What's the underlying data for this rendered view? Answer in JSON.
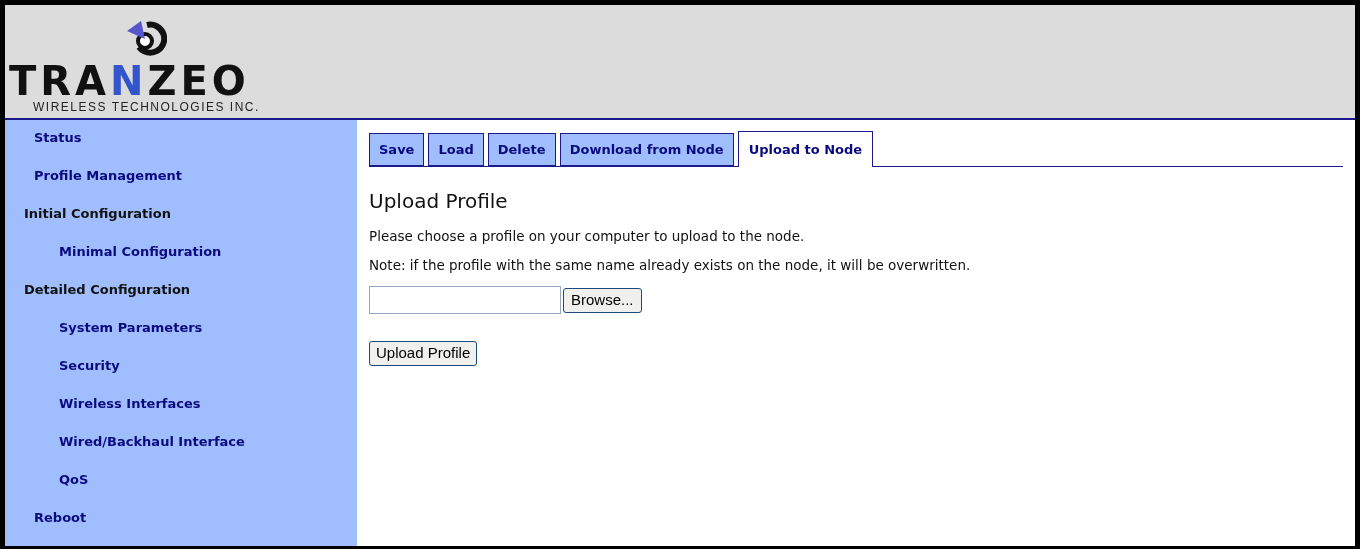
{
  "logo": {
    "parts": [
      {
        "text": "TRA",
        "highlight": false
      },
      {
        "text": "N",
        "highlight": true
      },
      {
        "text": "ZEO",
        "highlight": false
      }
    ],
    "tagline": "WIRELESS TECHNOLOGIES INC."
  },
  "sidebar": {
    "items": [
      {
        "label": "Status",
        "kind": "top"
      },
      {
        "label": "Profile Management",
        "kind": "top"
      },
      {
        "label": "Initial Configuration",
        "kind": "section"
      },
      {
        "label": "Minimal Configuration",
        "kind": "sub"
      },
      {
        "label": "Detailed Configuration",
        "kind": "section"
      },
      {
        "label": "System Parameters",
        "kind": "sub"
      },
      {
        "label": "Security",
        "kind": "sub"
      },
      {
        "label": "Wireless Interfaces",
        "kind": "sub"
      },
      {
        "label": "Wired/Backhaul Interface",
        "kind": "sub"
      },
      {
        "label": "QoS",
        "kind": "sub"
      },
      {
        "label": "Reboot",
        "kind": "top"
      }
    ]
  },
  "tabs": [
    {
      "label": "Save",
      "selected": false
    },
    {
      "label": "Load",
      "selected": false
    },
    {
      "label": "Delete",
      "selected": false
    },
    {
      "label": "Download from Node",
      "selected": false
    },
    {
      "label": "Upload to Node",
      "selected": true
    }
  ],
  "content": {
    "heading": "Upload Profile",
    "paragraphs": [
      "Please choose a profile on your computer to upload to the node.",
      "Note: if the profile with the same name already exists on the node, it will be overwritten."
    ],
    "browse_button": "Browse...",
    "upload_button": "Upload Profile"
  }
}
